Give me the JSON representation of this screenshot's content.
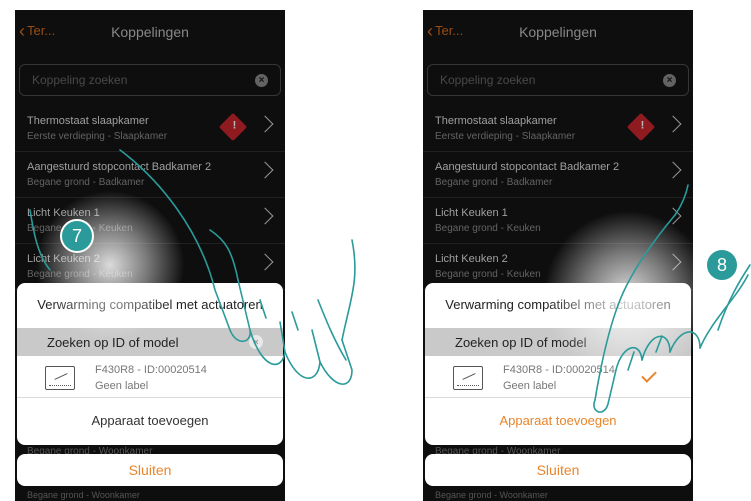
{
  "header": {
    "back_label": "Ter...",
    "title": "Koppelingen"
  },
  "search": {
    "placeholder": "Koppeling zoeken"
  },
  "list": [
    {
      "name": "Thermostaat slaapkamer",
      "location": "Eerste verdieping - Slaapkamer",
      "warning": true
    },
    {
      "name": "Aangestuurd stopcontact Badkamer 2",
      "location": "Begane grond - Badkamer",
      "warning": false
    },
    {
      "name": "Licht Keuken 1",
      "location": "Begane grond - Keuken",
      "warning": false
    },
    {
      "name": "Licht Keuken 2",
      "location": "Begane grond - Keuken",
      "warning": false
    }
  ],
  "dialog": {
    "title": "Verwarming compatibel met actuatoren",
    "filter_label": "Zoeken op ID of model",
    "device_id": "F430R8 - ID:00020514",
    "device_label": "Geen label",
    "add_button": "Apparaat toevoegen",
    "close_button": "Sluiten",
    "warning_glyph": "!"
  },
  "background_rows": {
    "row1": "Begane grond - Woonkamer",
    "row2": "Begane grond - Woonkamer"
  },
  "steps": {
    "left": "7",
    "right": "8"
  },
  "colors": {
    "accent": "#e8852a",
    "back": "#d06a1e",
    "warning": "#c6262e",
    "step": "#2b9a9a"
  },
  "icons": {
    "search_clear": "clear-icon",
    "warning": "warning-icon",
    "device": "relay-device-icon",
    "selected": "checkmark-icon"
  }
}
